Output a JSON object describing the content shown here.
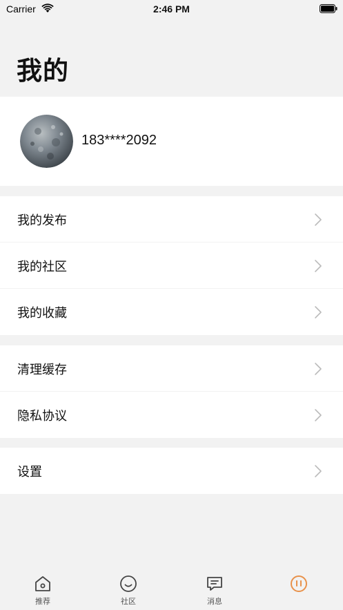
{
  "status_bar": {
    "carrier": "Carrier",
    "time": "2:46 PM"
  },
  "page": {
    "title": "我的"
  },
  "profile": {
    "phone": "183****2092"
  },
  "menu_groups": [
    {
      "items": [
        {
          "label": "我的发布"
        },
        {
          "label": "我的社区"
        },
        {
          "label": "我的收藏"
        }
      ]
    },
    {
      "items": [
        {
          "label": "清理缓存"
        },
        {
          "label": "隐私协议"
        }
      ]
    },
    {
      "items": [
        {
          "label": "设置"
        }
      ]
    }
  ],
  "tab_bar": {
    "tabs": [
      {
        "label": "推荐",
        "icon": "home-icon"
      },
      {
        "label": "社区",
        "icon": "smile-icon"
      },
      {
        "label": "消息",
        "icon": "message-icon"
      },
      {
        "label": "",
        "icon": "profile-icon"
      }
    ],
    "accent_color": "#e8914a"
  },
  "colors": {
    "background": "#f2f2f2",
    "card": "#ffffff",
    "chevron": "#bbbbbb"
  }
}
